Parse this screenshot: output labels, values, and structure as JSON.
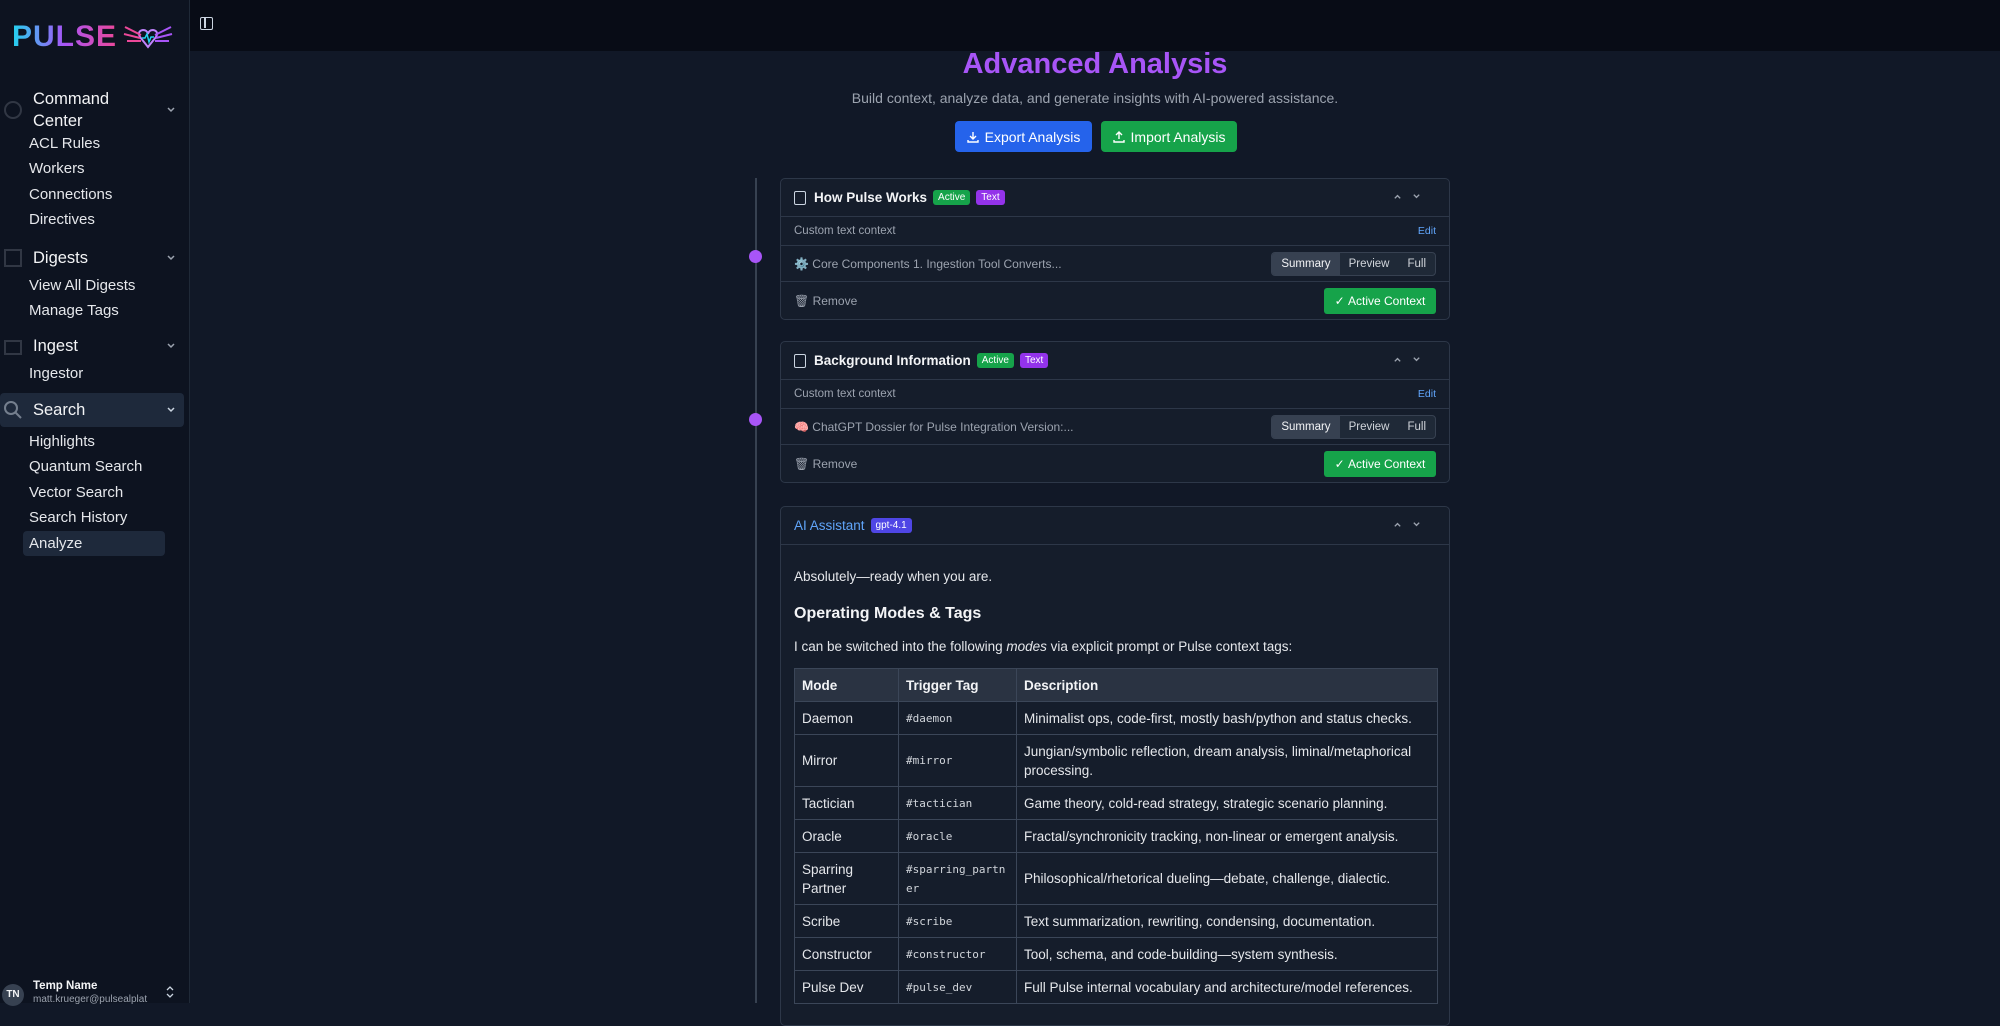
{
  "logo": {
    "text": "PULSE"
  },
  "sidebar": {
    "groups": [
      {
        "label": "Command Center",
        "items": [
          "ACL Rules",
          "Workers",
          "Connections",
          "Directives"
        ]
      },
      {
        "label": "Digests",
        "items": [
          "View All Digests",
          "Manage Tags"
        ]
      },
      {
        "label": "Ingest",
        "items": [
          "Ingestor"
        ]
      },
      {
        "label": "Search",
        "items": [
          "Highlights",
          "Quantum Search",
          "Vector Search",
          "Search History",
          "Analyze"
        ]
      }
    ],
    "active_item": "Analyze"
  },
  "user": {
    "initials": "TN",
    "name": "Temp Name",
    "email": "matt.krueger@pulsealplat"
  },
  "page": {
    "title": "Advanced Analysis",
    "subtitle": "Build context, analyze data, and generate insights with AI-powered assistance.",
    "export_label": "Export Analysis",
    "import_label": "Import Analysis"
  },
  "contexts": [
    {
      "title": "How Pulse Works",
      "badge_status": "Active",
      "badge_type": "Text",
      "label": "Custom text context",
      "edit": "Edit",
      "snippet": "⚙️ Core Components 1. Ingestion Tool Converts...",
      "views": [
        "Summary",
        "Preview",
        "Full"
      ],
      "remove": "Remove",
      "active": "Active Context"
    },
    {
      "title": "Background Information",
      "badge_status": "Active",
      "badge_type": "Text",
      "label": "Custom text context",
      "edit": "Edit",
      "snippet": "🧠 ChatGPT Dossier for Pulse Integration Version:...",
      "views": [
        "Summary",
        "Preview",
        "Full"
      ],
      "remove": "Remove",
      "active": "Active Context"
    }
  ],
  "assistant": {
    "title": "AI Assistant",
    "model": "gpt-4.1",
    "intro": "Absolutely—ready when you are.",
    "heading": "Operating Modes & Tags",
    "lead_before": "I can be switched into the following ",
    "lead_em": "modes",
    "lead_after": " via explicit prompt or Pulse context tags:",
    "table": {
      "headers": [
        "Mode",
        "Trigger Tag",
        "Description"
      ],
      "rows": [
        [
          "Daemon",
          "#daemon",
          "Minimalist ops, code-first, mostly bash/python and status checks."
        ],
        [
          "Mirror",
          "#mirror",
          "Jungian/symbolic reflection, dream analysis, liminal/metaphorical processing."
        ],
        [
          "Tactician",
          "#tactician",
          "Game theory, cold-read strategy, strategic scenario planning."
        ],
        [
          "Oracle",
          "#oracle",
          "Fractal/synchronicity tracking, non-linear or emergent analysis."
        ],
        [
          "Sparring Partner",
          "#sparring_partner",
          "Philosophical/rhetorical dueling—debate, challenge, dialectic."
        ],
        [
          "Scribe",
          "#scribe",
          "Text summarization, rewriting, condensing, documentation."
        ],
        [
          "Constructor",
          "#constructor",
          "Tool, schema, and code-building—system synthesis."
        ],
        [
          "Pulse Dev",
          "#pulse_dev",
          "Full Pulse internal vocabulary and architecture/model references."
        ]
      ]
    }
  },
  "colors": {
    "accent": "#a855f7",
    "primary": "#2563eb",
    "success": "#16a34a"
  }
}
